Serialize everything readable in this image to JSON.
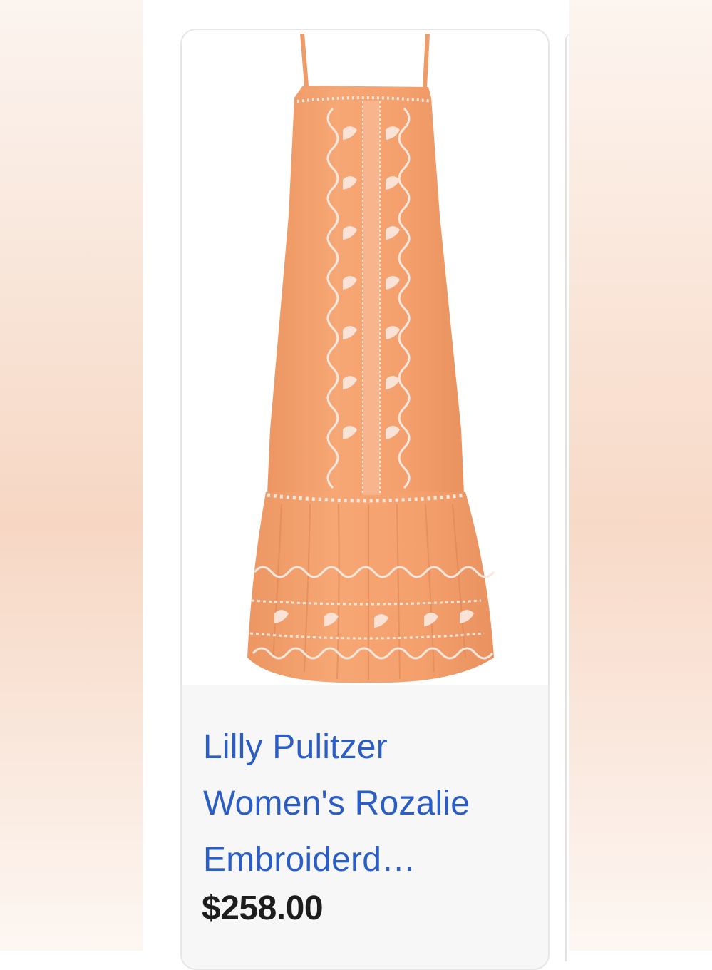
{
  "product": {
    "title_line1": "Lilly Pulitzer",
    "title_line2": "Women's Rozalie",
    "title_line3": "Embroiderd…",
    "price": "$258.00",
    "image_icon": "product-image-dress"
  },
  "colors": {
    "link": "#2b5dc6",
    "price": "#1d1d1d",
    "dress": "#f4a06e",
    "embroidery": "#fbe7dd"
  }
}
